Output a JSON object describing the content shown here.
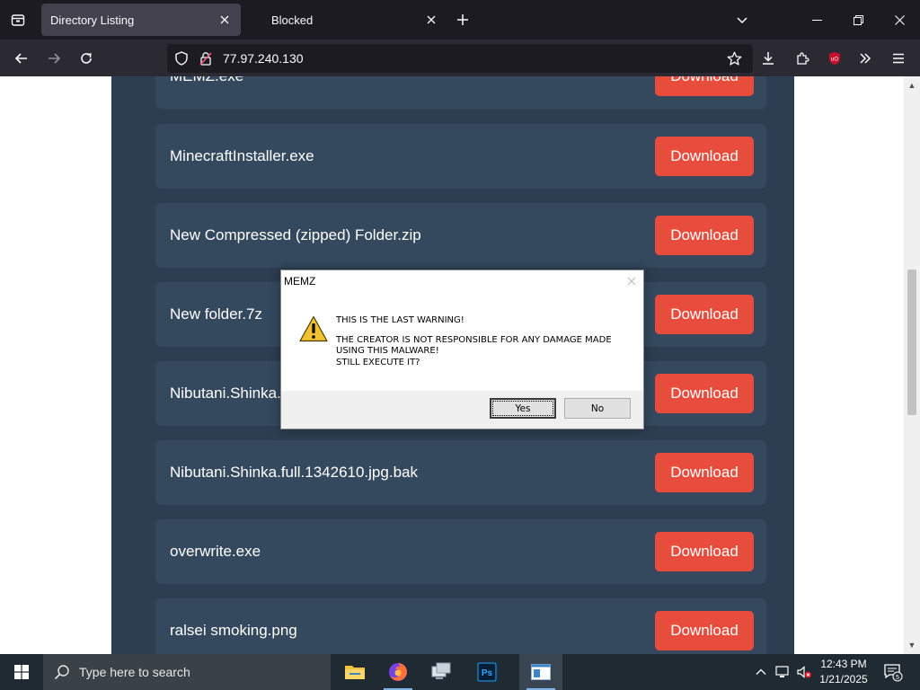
{
  "browser": {
    "tabs": [
      {
        "title": "Directory Listing",
        "active": true
      },
      {
        "title": "Blocked",
        "active": false
      }
    ],
    "url": "77.97.240.130"
  },
  "files": [
    {
      "name": "MEMZ.exe",
      "button": "Download"
    },
    {
      "name": "MinecraftInstaller.exe",
      "button": "Download"
    },
    {
      "name": "New Compressed (zipped) Folder.zip",
      "button": "Download"
    },
    {
      "name": "New folder.7z",
      "button": "Download"
    },
    {
      "name": "Nibutani.Shinka.fu",
      "button": "Download"
    },
    {
      "name": "Nibutani.Shinka.full.1342610.jpg.bak",
      "button": "Download"
    },
    {
      "name": "overwrite.exe",
      "button": "Download"
    },
    {
      "name": "ralsei smoking.png",
      "button": "Download"
    }
  ],
  "dialog": {
    "title": "MEMZ",
    "icon": "warning-icon",
    "line1": "THIS IS THE LAST WARNING!",
    "line2": "THE CREATOR IS NOT RESPONSIBLE FOR ANY DAMAGE MADE",
    "line3": "USING THIS MALWARE!",
    "line4": "STILL EXECUTE IT?",
    "yes_label": "Yes",
    "no_label": "No"
  },
  "taskbar": {
    "search_placeholder": "Type here to search",
    "time": "12:43 PM",
    "date": "1/21/2025",
    "notification_count": "5",
    "apps": [
      "file-explorer-icon",
      "firefox-icon",
      "remote-desktop-icon",
      "photoshop-icon",
      "window-app-icon"
    ]
  },
  "colors": {
    "panel_bg": "#2c3e50",
    "row_bg": "#34495e",
    "download_button": "#e74c3c",
    "tabbar_bg": "#1c1b22",
    "navbar_bg": "#2b2a33",
    "taskbar_bg": "#1f2a33"
  }
}
